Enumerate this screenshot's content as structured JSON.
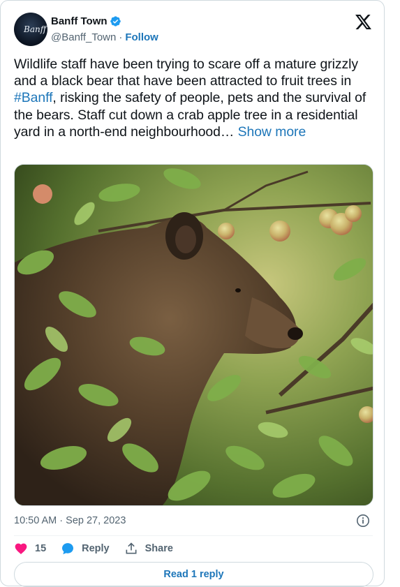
{
  "author": {
    "display_name": "Banff Town",
    "handle": "@Banff_Town",
    "separator": "·",
    "follow_label": "Follow",
    "avatar_text": "Banff",
    "verified": true
  },
  "tweet": {
    "text_before_tag": "Wildlife staff have been trying to scare off a mature grizzly and a black bear that have been attracted to fruit trees in ",
    "hashtag": "#Banff",
    "text_after_tag": ", risking the safety of people, pets and the survival of the bears. Staff cut down a crab apple tree in a residential yard in a north-end neighbourhood… ",
    "show_more_label": "Show more"
  },
  "media": {
    "icon": "photo-grizzly-bear-in-apple-tree"
  },
  "meta": {
    "timestamp": "10:50 AM · Sep 27, 2023"
  },
  "actions": {
    "like_count": "15",
    "reply_label": "Reply",
    "share_label": "Share"
  },
  "read_replies_label": "Read 1 reply",
  "colors": {
    "accent": "#1d76b9",
    "like": "#f91880",
    "verified": "#1d9bf0",
    "muted_text": "#536471",
    "border": "#cfd9de"
  }
}
